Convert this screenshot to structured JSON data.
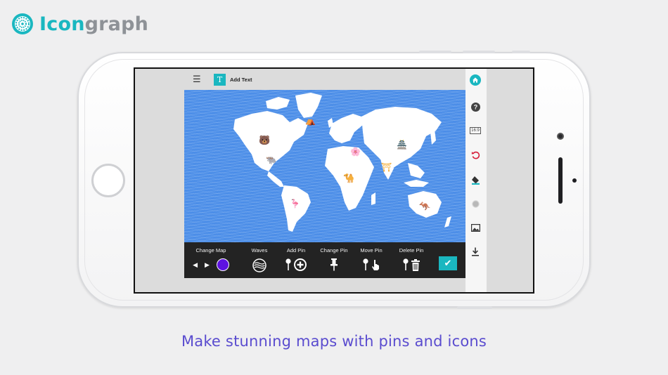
{
  "brand": {
    "name_part1": "Icon",
    "name_part2": "graph",
    "accent": "#1ab7c0",
    "logo_icon": "gear-sunburst-icon"
  },
  "editor": {
    "top_bar": {
      "menu_icon": "hamburger-icon",
      "add_text_icon": "text-t-icon",
      "add_text_label": "Add Text"
    },
    "map": {
      "style": "Waves",
      "ocean_color": "#4c8ee8",
      "land_color": "#ffffff",
      "pins": [
        "polar-bear-icon",
        "bison-icon",
        "igloo-icon",
        "flamingo-icon",
        "matryoshka-icon",
        "camel-icon",
        "pagoda-icon",
        "great-wall-icon",
        "kangaroo-icon"
      ]
    },
    "toolbar": {
      "change_map_label": "Change Map",
      "waves_label": "Waves",
      "add_pin_label": "Add Pin",
      "change_pin_label": "Change Pin",
      "move_pin_label": "Move Pin",
      "delete_pin_label": "Delete Pin",
      "selected_color": "#5d12e0",
      "confirm_icon": "check-icon"
    },
    "sidebar": [
      "home-icon",
      "help-icon",
      "aspect-ratio-icon",
      "undo-icon",
      "paint-bucket-icon",
      "circle-icon",
      "image-icon",
      "download-icon"
    ],
    "aspect_ratio_label": "16:9"
  },
  "tagline": "Make stunning maps with pins and icons"
}
